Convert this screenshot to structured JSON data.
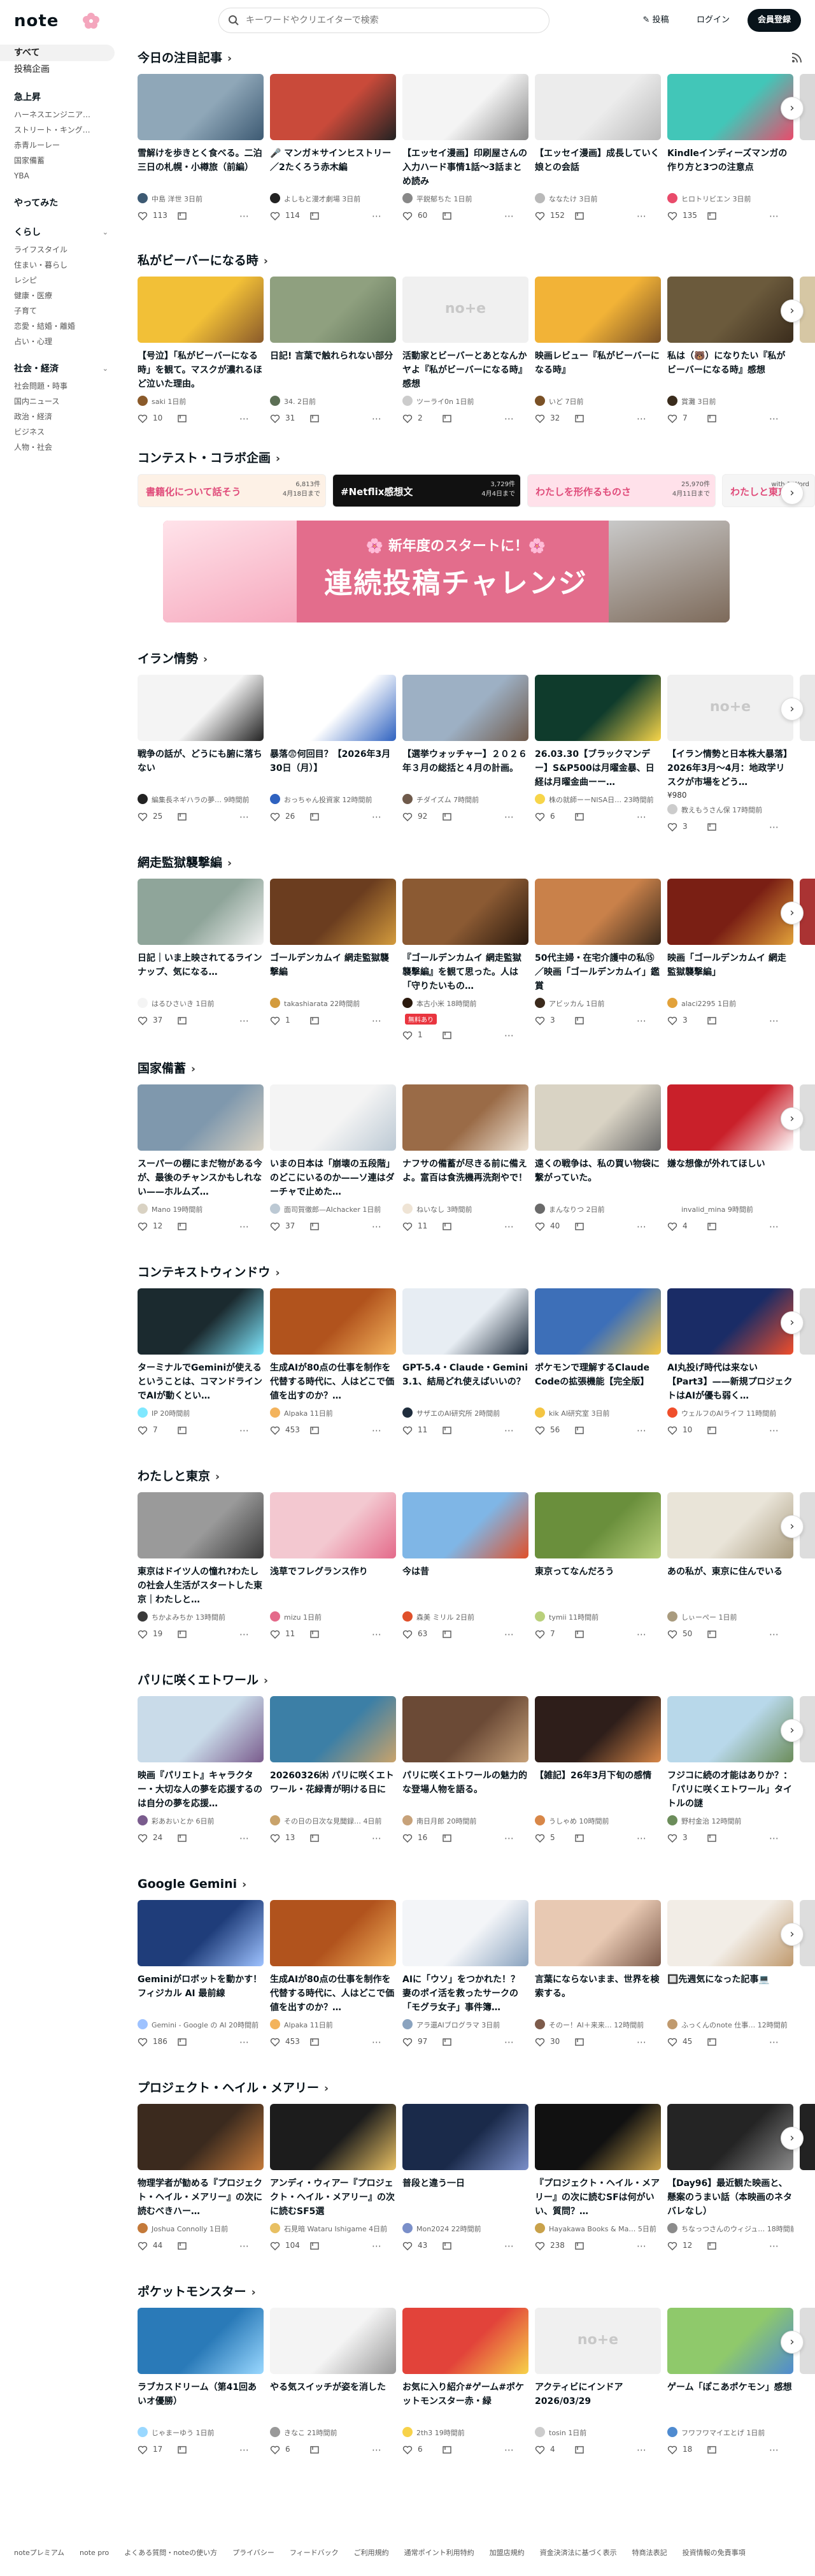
{
  "header": {
    "logo": "note",
    "search_placeholder": "キーワードやクリエイターで検索",
    "post": "投稿",
    "login": "ログイン",
    "signup": "会員登録"
  },
  "sidebar": {
    "top": [
      {
        "label": "すべて"
      },
      {
        "label": "投稿企画"
      }
    ],
    "groups": [
      {
        "head": "急上昇",
        "items": [
          "ハーネスエンジニア…",
          "ストリート・キング…",
          "赤青ルーレー",
          "国家備蓄",
          "YBA"
        ],
        "chev": ""
      },
      {
        "head": "やってみた",
        "items": [],
        "chev": ""
      },
      {
        "head": "くらし",
        "items": [
          "ライフスタイル",
          "住まい・暮らし",
          "レシピ",
          "健康・医療",
          "子育て",
          "恋愛・結婚・離婚",
          "占い・心理"
        ],
        "chev": "⌄"
      },
      {
        "head": "社会・経済",
        "items": [
          "社会問題・時事",
          "国内ニュース",
          "政治・経済",
          "ビジネス",
          "人物・社会"
        ],
        "chev": "⌄"
      }
    ]
  },
  "sections": [
    {
      "title": "今日の注目記事",
      "rss": true,
      "cards": [
        {
          "title": "雪解けを歩きとく食べる。二泊三日の札幌・小樽旅（前編）",
          "author": "中島 洋世",
          "time": "3日前",
          "likes": "113",
          "thumb": "#8fa7b8",
          "thumb2": "#3d5a73"
        },
        {
          "title": "🎤 マンガ＊サインヒストリー／2たくろう赤木編",
          "author": "よしもと漫才劇場",
          "time": "3日前",
          "likes": "114",
          "thumb": "#c94a3a",
          "thumb2": "#222"
        },
        {
          "title": "【エッセイ漫画】印刷屋さんの入力ハード事情1話〜3話まとめ読み",
          "author": "平鋭郁ちた",
          "time": "1日前",
          "likes": "60",
          "thumb": "#f4f4f4",
          "thumb2": "#888"
        },
        {
          "title": "【エッセイ漫画】成長していく娘との会話",
          "author": "ななたけ",
          "time": "3日前",
          "likes": "152",
          "thumb": "#ececec",
          "thumb2": "#b9b9b9"
        },
        {
          "title": "Kindleインディーズマンガの作り方と3つの注意点",
          "author": "ヒロトリビエン",
          "time": "3日前",
          "likes": "135",
          "thumb": "#42c6b8",
          "thumb2": "#e94b6b"
        },
        {
          "title": "",
          "author": "",
          "time": "",
          "likes": "",
          "thumb": "#d8d8d8",
          "thumb2": "#aaa"
        }
      ]
    },
    {
      "title": "私がビーバーになる時",
      "cards": [
        {
          "title": "【号泣】「私がビーバーになる時」を観て。マスクが濃れるほど泣いた理由。",
          "author": "saki",
          "time": "1日前",
          "likes": "10",
          "thumb": "#f2c037",
          "thumb2": "#8a5a2a"
        },
        {
          "title": "日記! 言葉で触れられない部分",
          "author": "34.",
          "time": "2日前",
          "likes": "31",
          "thumb": "#8fa07f",
          "thumb2": "#5c6f55"
        },
        {
          "title": "活動家とビーバーとあとなんかヤよ『私がビーバーになる時』感想",
          "author": "ツーライ0n",
          "time": "1日前",
          "likes": "2",
          "thumb": "#f0f0f0",
          "thumb2": "#ccc",
          "ph": true
        },
        {
          "title": "映画レビュー『私がビーバーになる時』",
          "author": "いど",
          "time": "7日前",
          "likes": "32",
          "thumb": "#f2b337",
          "thumb2": "#7a5126"
        },
        {
          "title": "私は（🐻）になりたい『私がビーバーになる時』感想",
          "author": "賞灘",
          "time": "3日前",
          "likes": "7",
          "thumb": "#6b5a3c",
          "thumb2": "#3a2c1c"
        },
        {
          "title": "",
          "author": "",
          "time": "",
          "likes": "",
          "thumb": "#d6c7a4",
          "thumb2": "#aaa"
        }
      ]
    },
    {
      "title": "イラン情勢",
      "cards": [
        {
          "title": "戦争の話が、どうにも腑に落ちない",
          "author": "編集長ネギハラの夢…",
          "time": "9時間前",
          "likes": "25",
          "thumb": "#f4f4f4",
          "thumb2": "#222"
        },
        {
          "title": "暴落😨何回目？【2026年3月30日（月）】",
          "author": "おっちゃん投資家",
          "time": "12時間前",
          "likes": "26",
          "thumb": "#fff",
          "thumb2": "#2f62c0"
        },
        {
          "title": "【選挙ウォッチャー】２０２６年３月の総括と４月の計画。",
          "author": "チダイズム",
          "time": "7時間前",
          "likes": "92",
          "thumb": "#9db0c4",
          "thumb2": "#6f5a4b"
        },
        {
          "title": "26.03.30【ブラックマンデー】S&P500は月曜金暴、日経は月曜金曲ーー…",
          "author": "株の就師ーーNISA日…",
          "time": "23時間前",
          "likes": "6",
          "thumb": "#0f3b2c",
          "thumb2": "#f7d54a"
        },
        {
          "title": "【イラン情勢と日本株大暴落】2026年3月〜4月：地政学リスクが市場をどう…",
          "author": "教えもうさん保",
          "time": "17時間前",
          "likes": "3",
          "thumb": "#f0f0f0",
          "thumb2": "#ccc",
          "ph": true,
          "extra": "¥980"
        },
        {
          "title": "",
          "author": "",
          "time": "",
          "likes": "",
          "thumb": "#e8e8e8",
          "thumb2": "#aaa"
        }
      ]
    },
    {
      "title": "網走監獄襲撃編",
      "cards": [
        {
          "title": "日記｜いま上映されてるラインナップ、気になる…",
          "author": "はるひさいき",
          "time": "1日前",
          "likes": "37",
          "thumb": "#8fa59a",
          "thumb2": "#f4f4f4"
        },
        {
          "title": "ゴールデンカムイ 網走監獄襲撃編",
          "author": "takashiarata",
          "time": "22時間前",
          "likes": "1",
          "thumb": "#6b3d1f",
          "thumb2": "#d39b3d"
        },
        {
          "title": "『ゴールデンカムイ 網走監獄襲撃編』を観て思った。人は「守りたいもの…",
          "author": "本古小米",
          "time": "18時間前",
          "likes": "1",
          "thumb": "#8b5a33",
          "thumb2": "#2b1a0e",
          "badge": "無料あり"
        },
        {
          "title": "50代主婦・在宅介護中の私⑮／映画「ゴールデンカムイ」鑑賞",
          "author": "アビッカん",
          "time": "1日前",
          "likes": "3",
          "thumb": "#c9814a",
          "thumb2": "#3b2a1c"
        },
        {
          "title": "映画「ゴールデンカムイ 網走監獄襲撃編」",
          "author": "alaci2295",
          "time": "1日前",
          "likes": "3",
          "thumb": "#7a1f14",
          "thumb2": "#e2a23a"
        },
        {
          "title": "",
          "author": "",
          "time": "",
          "likes": "",
          "thumb": "#a33",
          "thumb2": "#aaa"
        }
      ]
    },
    {
      "title": "国家備蓄",
      "cards": [
        {
          "title": "スーパーの棚にまだ物がある今が、最後のチャンスかもしれない——ホルムズ…",
          "author": "Mano",
          "time": "19時間前",
          "likes": "12",
          "thumb": "#7f98ad",
          "thumb2": "#d9d2c3"
        },
        {
          "title": "いまの日本は「崩壊の五段階」のどこにいるのか——ソ連はダーチャで止めた…",
          "author": "面司賀徹郎—AIchacker",
          "time": "1日前",
          "likes": "37",
          "thumb": "#f4f4f4",
          "thumb2": "#bcc9d4"
        },
        {
          "title": "ナフサの備蓄が尽きる前に備えよ。富百は食洗機再洗剤やで！",
          "author": "ねいなし",
          "time": "3時間前",
          "likes": "11",
          "thumb": "#9a6b47",
          "thumb2": "#efe4d5"
        },
        {
          "title": "遠くの戦争は、私の買い物袋に繋がっていた。",
          "author": "まんなりつ",
          "time": "2日前",
          "likes": "40",
          "thumb": "#d9d3c4",
          "thumb2": "#6a6a6a"
        },
        {
          "title": "嫌な想像が外れてほしい",
          "author": "invalid_mina",
          "time": "9時間前",
          "likes": "4",
          "thumb": "#c9202a",
          "thumb2": "#fff"
        },
        {
          "title": "",
          "author": "",
          "time": "",
          "likes": "",
          "thumb": "#ddd",
          "thumb2": "#aaa"
        }
      ]
    },
    {
      "title": "コンテキストウィンドウ",
      "cards": [
        {
          "title": "ターミナルでGeminiが使えるということは、コマンドラインでAIが動くとい…",
          "author": "IP",
          "time": "20時間前",
          "likes": "7",
          "thumb": "#1b2a2f",
          "thumb2": "#7fe8ff"
        },
        {
          "title": "生成AIが80点の仕事を制作を代替する時代に、人はどこで価値を出すのか？…",
          "author": "Alpaka",
          "time": "11日前",
          "likes": "453",
          "thumb": "#b1531d",
          "thumb2": "#f3b35c"
        },
        {
          "title": "GPT-5.4・Claude・Gemini 3.1、結局どれ使えばいいの？",
          "author": "サザエのAI研究所",
          "time": "2時間前",
          "likes": "11",
          "thumb": "#e7edf3",
          "thumb2": "#1f2d3d"
        },
        {
          "title": "ポケモンで理解するClaude Codeの拡張機能【完全版】",
          "author": "kik AI研究室",
          "time": "3日前",
          "likes": "56",
          "thumb": "#3d6fb8",
          "thumb2": "#f4c542"
        },
        {
          "title": "AI丸投げ時代は来ない【Part3】——新規プロジェクトはAIが優も弱く…",
          "author": "ウェルフのAIライフ",
          "time": "11時間前",
          "likes": "10",
          "thumb": "#1a2c66",
          "thumb2": "#f04e2b"
        },
        {
          "title": "",
          "author": "",
          "time": "",
          "likes": "",
          "thumb": "#ddd",
          "thumb2": "#aaa"
        }
      ]
    },
    {
      "title": "わたしと東京",
      "cards": [
        {
          "title": "東京はドイツ人の憧れ?わたしの社会人生活がスタートした東京｜わたしと…",
          "author": "ちかよみちか",
          "time": "13時間前",
          "likes": "19",
          "thumb": "#9a9a9a",
          "thumb2": "#3a3a3a"
        },
        {
          "title": "浅草でフレグランス作り",
          "author": "mizu",
          "time": "1日前",
          "likes": "11",
          "thumb": "#f3c8d0",
          "thumb2": "#e46a8a"
        },
        {
          "title": "今は昔",
          "author": "森美 ミリル",
          "time": "2日前",
          "likes": "63",
          "thumb": "#7fb6e6",
          "thumb2": "#e0502a"
        },
        {
          "title": "東京ってなんだろう",
          "author": "tymii",
          "time": "11時間前",
          "likes": "7",
          "thumb": "#6a8f3c",
          "thumb2": "#b9d07b"
        },
        {
          "title": "あの私が、東京に住んでいる",
          "author": "しぃーぺー",
          "time": "1日前",
          "likes": "50",
          "thumb": "#e9e4d8",
          "thumb2": "#a99b7e"
        },
        {
          "title": "",
          "author": "",
          "time": "",
          "likes": "",
          "thumb": "#ddd",
          "thumb2": "#aaa"
        }
      ]
    },
    {
      "title": "パリに咲くエトワール",
      "cards": [
        {
          "title": "映画『パリエト』キャラクター・大切な人の夢を応援するのは自分の夢を応援…",
          "author": "彩あおいとか",
          "time": "6日前",
          "likes": "24",
          "thumb": "#c9dbe9",
          "thumb2": "#7a5c8d"
        },
        {
          "title": "20260326㈭ パリに咲くエトワール・花緑青が明ける日に",
          "author": "その日の日次な見聞録…",
          "time": "4日前",
          "likes": "13",
          "thumb": "#3c7fa6",
          "thumb2": "#c9a36b"
        },
        {
          "title": "パリに咲くエトワールの魅力的な登場人物を語る。",
          "author": "南日月郎",
          "time": "20時間前",
          "likes": "16",
          "thumb": "#6b4a36",
          "thumb2": "#c7a27a"
        },
        {
          "title": "【雑記】26年3月下旬の感情",
          "author": "うしゃめ",
          "time": "10時間前",
          "likes": "5",
          "thumb": "#2e1e1a",
          "thumb2": "#d88748"
        },
        {
          "title": "フジコに続の才能はありか？：「パリに咲くエトワール」タイトルの謎",
          "author": "野村金治",
          "time": "12時間前",
          "likes": "3",
          "thumb": "#b8d8ea",
          "thumb2": "#6c8d5b"
        },
        {
          "title": "",
          "author": "",
          "time": "",
          "likes": "",
          "thumb": "#ddd",
          "thumb2": "#aaa"
        }
      ]
    },
    {
      "title": "Google Gemini",
      "cards": [
        {
          "title": "Geminiがロボットを動かす！フィジカル AI 最前線",
          "author": "Gemini - Google の AI",
          "time": "20時間前",
          "likes": "186",
          "thumb": "#1f3d7a",
          "thumb2": "#9ec2ff"
        },
        {
          "title": "生成AIが80点の仕事を制作を代替する時代に、人はどこで価値を出すのか？…",
          "author": "Alpaka",
          "time": "11日前",
          "likes": "453",
          "thumb": "#b1531d",
          "thumb2": "#f3b35c"
        },
        {
          "title": "AIに「ウソ」をつかれた！？妻のポイ活を救ったサークの「モグラ女子」事件簿…",
          "author": "アラ還AIブログラマ",
          "time": "3日前",
          "likes": "97",
          "thumb": "#f3f5f8",
          "thumb2": "#8aa3bf"
        },
        {
          "title": "言葉にならないまま、世界を検索する。",
          "author": "そのー！AI＋来来…",
          "time": "12時間前",
          "likes": "30",
          "thumb": "#e8c9b3",
          "thumb2": "#7d5b4b"
        },
        {
          "title": "🔲先週気になった記事💻",
          "author": "ふっくんのnote 仕事…",
          "time": "12時間前",
          "likes": "45",
          "thumb": "#f2ede6",
          "thumb2": "#c09a6e"
        },
        {
          "title": "",
          "author": "",
          "time": "",
          "likes": "",
          "thumb": "#ddd",
          "thumb2": "#aaa"
        }
      ]
    },
    {
      "title": "プロジェクト・ヘイル・メアリー",
      "cards": [
        {
          "title": "物理学者が勧める『プロジェクト・ヘイル・メアリー』の次に読むべきハー…",
          "author": "Joshua Connolly",
          "time": "1日前",
          "likes": "44",
          "thumb": "#3b2a1e",
          "thumb2": "#c47a3a"
        },
        {
          "title": "アンディ・ウィアー『プロジェクト・ヘイル・メアリー』の次に読むSF5選",
          "author": "石見暗 Wataru Ishigame",
          "time": "4日前",
          "likes": "104",
          "thumb": "#1c1c1c",
          "thumb2": "#e8c063"
        },
        {
          "title": "普段と違う一日",
          "author": "Mon2024",
          "time": "22時間前",
          "likes": "43",
          "thumb": "#1a2a4a",
          "thumb2": "#7a8fc9"
        },
        {
          "title": "『プロジェクト・ヘイル・メアリー』の次に読むSFは何がいい、質問？…",
          "author": "Hayakawa Books & Ma…",
          "time": "5日前",
          "likes": "238",
          "thumb": "#111",
          "thumb2": "#c9a24b"
        },
        {
          "title": "【Day96】最近観た映画と、懸案のうまい話（本映画のネタバレなし）",
          "author": "ちなっつさんのウィジュ…",
          "time": "18時間前",
          "likes": "12",
          "thumb": "#242424",
          "thumb2": "#8b8b8b"
        },
        {
          "title": "",
          "author": "",
          "time": "",
          "likes": "",
          "thumb": "#222",
          "thumb2": "#aaa"
        }
      ]
    },
    {
      "title": "ポケットモンスター",
      "cards": [
        {
          "title": "ラブカスドリーム（第41回あいオ優勝）",
          "author": "じゃまーゆう",
          "time": "1日前",
          "likes": "17",
          "thumb": "#2a7ab8",
          "thumb2": "#9ad8ff"
        },
        {
          "title": "やる気スイッチが姿を消した",
          "author": "きなこ",
          "time": "21時間前",
          "likes": "6",
          "thumb": "#f4f4f4",
          "thumb2": "#999"
        },
        {
          "title": "お気に入り紹介#ゲーム#ポケットモンスター赤・緑",
          "author": "2th3",
          "time": "19時間前",
          "likes": "6",
          "thumb": "#e2433a",
          "thumb2": "#f7d24a"
        },
        {
          "title": "アクティビにインドア 2026/03/29",
          "author": "tosin",
          "time": "1日前",
          "likes": "4",
          "thumb": "#f0f0f0",
          "thumb2": "#ccc",
          "ph": true
        },
        {
          "title": "ゲーム「ぽこあポケモン」感想",
          "author": "フワフワマイエとげ",
          "time": "1日前",
          "likes": "18",
          "thumb": "#8fc96b",
          "thumb2": "#4f8bd0"
        },
        {
          "title": "",
          "author": "",
          "time": "",
          "likes": "",
          "thumb": "#ddd",
          "thumb2": "#aaa"
        }
      ]
    }
  ],
  "contest": {
    "title": "コンテスト・コラボ企画",
    "banners": [
      {
        "text": "書籍化について話そう",
        "meta1": "6,813件",
        "meta2": "4月18日まで",
        "bg": "#fdf1e6"
      },
      {
        "text": "#Netflix感想文",
        "meta1": "3,729件",
        "meta2": "4月4日まで",
        "bg": "#111"
      },
      {
        "text": "わたしを形作るものさ",
        "meta1": "25,970件",
        "meta2": "4月11日まで",
        "bg": "#ffe1ea"
      },
      {
        "text": "わたしと東京",
        "meta1": "",
        "meta2": "with 1 Word",
        "bg": "#f5f5f5"
      }
    ],
    "hero_sub": "🌸 新年度のスタートに！🌸",
    "hero_main": "連続投稿チャレンジ"
  },
  "footer": {
    "links": [
      "noteプレミアム",
      "note pro",
      "よくある質問・noteの使い方",
      "プライバシー",
      "フィードバック",
      "ご利用規約",
      "通常ポイント利用特約",
      "加盟店規約",
      "資金決済法に基づく表示",
      "特商法表記",
      "投資情報の免責事項"
    ]
  }
}
